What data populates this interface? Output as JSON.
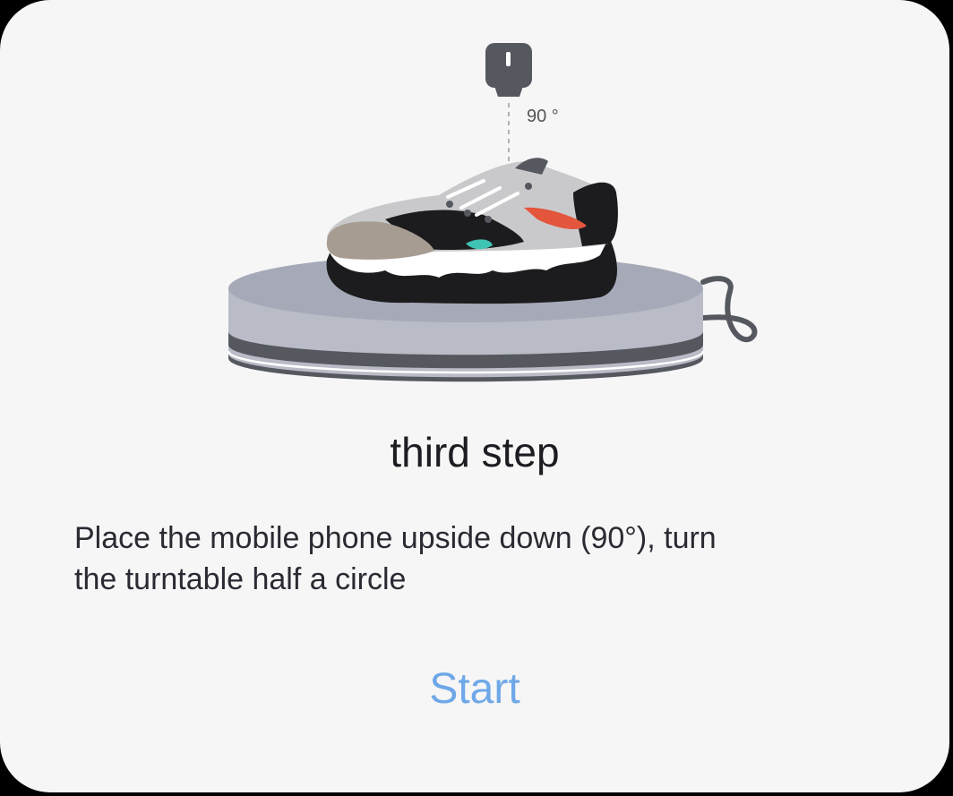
{
  "illustration": {
    "angle_label": "90 °",
    "accent_colors": {
      "turntable_top": "#a6a9b8",
      "turntable_stripe": "#5a5d66",
      "shoe_orange": "#e4553d",
      "shoe_teal": "#3fc3b3",
      "shoe_tan": "#a79c92"
    }
  },
  "step": {
    "title": "third step",
    "description_line1": "Place the mobile phone upside down (90°), turn",
    "description_line2": "the turntable half a circle"
  },
  "actions": {
    "start_label": "Start",
    "start_color": "#6fa8e8"
  }
}
